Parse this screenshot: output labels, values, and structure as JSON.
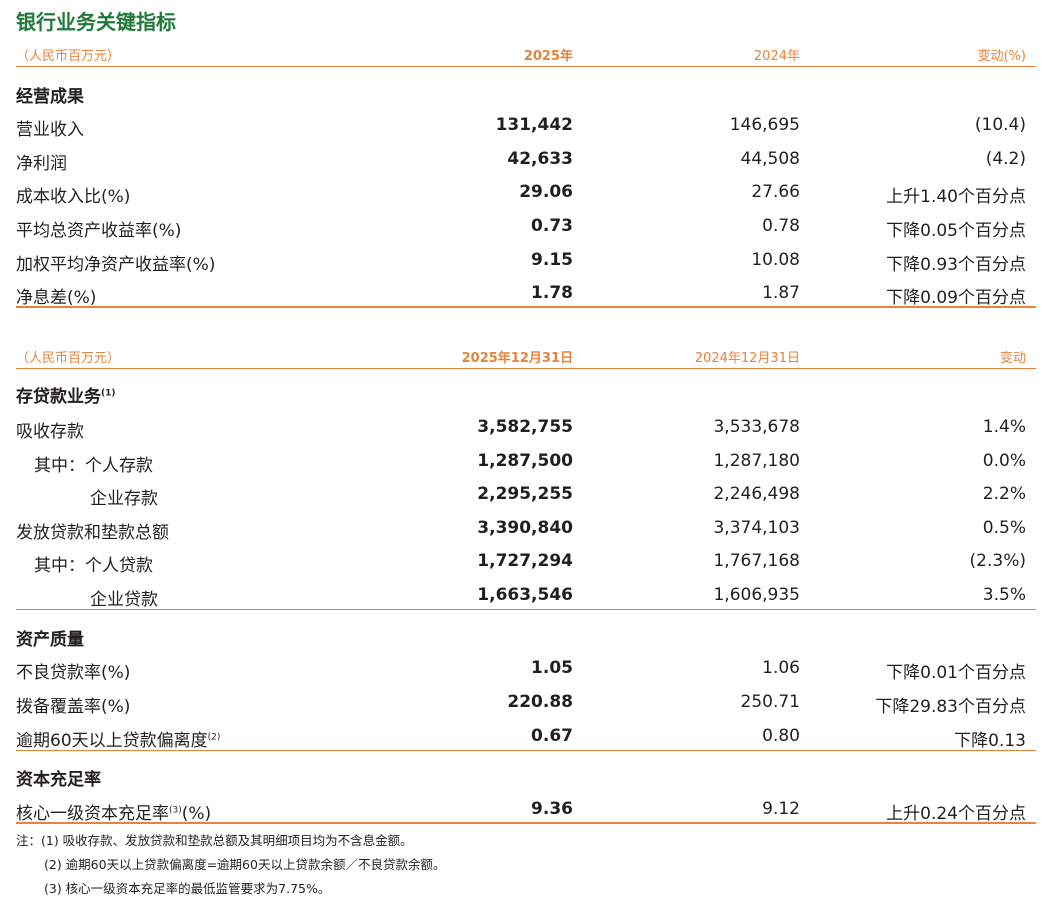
{
  "title": "银行业务关键指标",
  "table1": {
    "header": {
      "unit": "（人民币百万元）",
      "c1": "2025年",
      "c2": "2024年",
      "c3": "变动(%)"
    },
    "section": "经营成果",
    "rows": [
      {
        "label": "营业收入",
        "v1": "131,442",
        "v2": "146,695",
        "v3": "(10.4)"
      },
      {
        "label": "净利润",
        "v1": "42,633",
        "v2": "44,508",
        "v3": "(4.2)"
      },
      {
        "label": "成本收入比(%)",
        "v1": "29.06",
        "v2": "27.66",
        "v3": "上升1.40个百分点"
      },
      {
        "label": "平均总资产收益率(%)",
        "v1": "0.73",
        "v2": "0.78",
        "v3": "下降0.05个百分点"
      },
      {
        "label": "加权平均净资产收益率(%)",
        "v1": "9.15",
        "v2": "10.08",
        "v3": "下降0.93个百分点"
      },
      {
        "label": "净息差(%)",
        "v1": "1.78",
        "v2": "1.87",
        "v3": "下降0.09个百分点"
      }
    ]
  },
  "table2": {
    "header": {
      "unit": "（人民币百万元）",
      "c1": "2025年12月31日",
      "c2": "2024年12月31日",
      "c3": "变动"
    },
    "sections": [
      {
        "title": "存贷款业务",
        "sup": "(1)",
        "rows": [
          {
            "label": "吸收存款",
            "v1": "3,582,755",
            "v2": "3,533,678",
            "v3": "1.4%"
          },
          {
            "label": "其中：个人存款",
            "v1": "1,287,500",
            "v2": "1,287,180",
            "v3": "0.0%"
          },
          {
            "label": "企业存款",
            "v1": "2,295,255",
            "v2": "2,246,498",
            "v3": "2.2%"
          },
          {
            "label": "发放贷款和垫款总额",
            "v1": "3,390,840",
            "v2": "3,374,103",
            "v3": "0.5%"
          },
          {
            "label": "其中：个人贷款",
            "v1": "1,727,294",
            "v2": "1,767,168",
            "v3": "(2.3%)"
          },
          {
            "label": "企业贷款",
            "v1": "1,663,546",
            "v2": "1,606,935",
            "v3": "3.5%"
          }
        ]
      },
      {
        "title": "资产质量",
        "rows": [
          {
            "label": "不良贷款率(%)",
            "v1": "1.05",
            "v2": "1.06",
            "v3": "下降0.01个百分点"
          },
          {
            "label": "拨备覆盖率(%)",
            "v1": "220.88",
            "v2": "250.71",
            "v3": "下降29.83个百分点"
          },
          {
            "label": "逾期60天以上贷款偏离度",
            "sup": "(2)",
            "v1": "0.67",
            "v2": "0.80",
            "v3": "下降0.13"
          }
        ]
      },
      {
        "title": "资本充足率",
        "rows": [
          {
            "label": "核心一级资本充足率",
            "sup": "(3)",
            "label_suffix": "(%)",
            "v1": "9.36",
            "v2": "9.12",
            "v3": "上升0.24个百分点"
          }
        ]
      }
    ]
  },
  "notes": [
    "注：(1)  吸收存款、发放贷款和垫款总额及其明细项目均为不含息金额。",
    "(2)  逾期60天以上贷款偏离度=逾期60天以上贷款余额／不良贷款余额。",
    "(3)  核心一级资本充足率的最低监管要求为7.75%。"
  ]
}
